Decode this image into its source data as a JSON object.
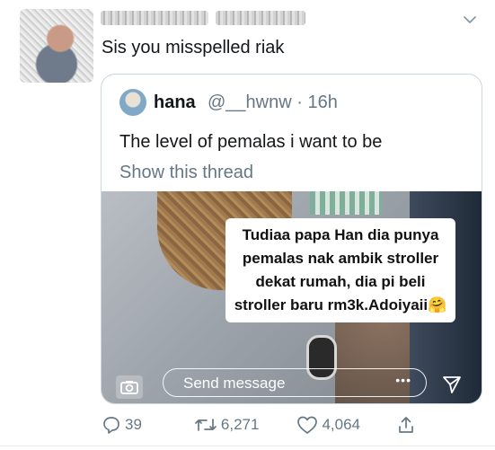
{
  "tweet": {
    "reply_text": "Sis you misspelled riak"
  },
  "quoted_tweet": {
    "name": "hana",
    "handle_time": "@__hwnw · 16h",
    "text": "The level of pemalas i want to be",
    "show_thread": "Show this thread",
    "media": {
      "caption": "Tudiaa papa Han dia punya pemalas nak ambik stroller dekat rumah, dia pi beli stroller baru rm3k.Adoiyaii🤗",
      "message_placeholder": "Send message",
      "more_dots": "•••"
    }
  },
  "actions": {
    "replies": "39",
    "retweets": "6,271",
    "likes": "4,064"
  },
  "icons": [
    "chevron-down-icon",
    "camera-icon",
    "send-icon",
    "reply-icon",
    "retweet-icon",
    "like-icon",
    "share-icon"
  ],
  "colors": {
    "muted": "#657786",
    "border": "#ccd6dd",
    "text": "#14171a"
  }
}
